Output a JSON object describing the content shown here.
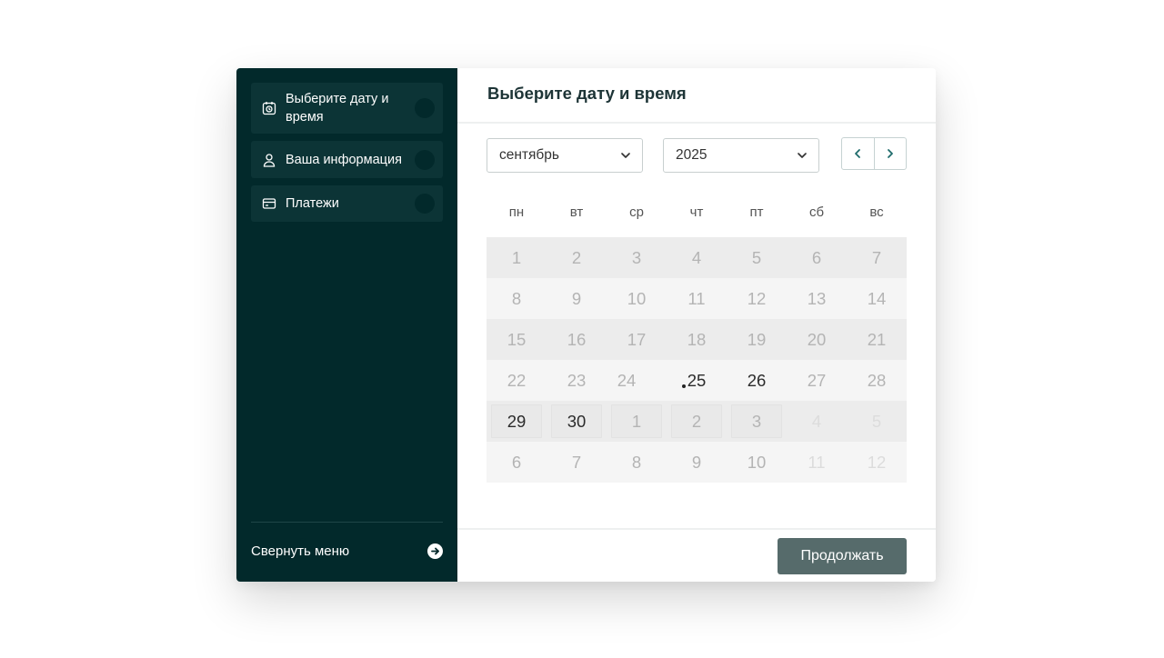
{
  "sidebar": {
    "steps": [
      {
        "label": "Выберите дату и время",
        "icon": "calendar-clock-icon"
      },
      {
        "label": "Ваша информация",
        "icon": "user-icon"
      },
      {
        "label": "Платежи",
        "icon": "credit-card-icon"
      }
    ],
    "collapse_label": "Свернуть меню",
    "colors": {
      "background": "#02292b",
      "step_background": "#0c3436"
    }
  },
  "main": {
    "title": "Выберите дату и время",
    "month_select": {
      "value": "сентябрь"
    },
    "year_select": {
      "value": "2025"
    },
    "weekdays": [
      "пн",
      "вт",
      "ср",
      "чт",
      "пт",
      "сб",
      "вс"
    ],
    "weeks": [
      [
        {
          "d": "1",
          "s": "disabled"
        },
        {
          "d": "2",
          "s": "disabled"
        },
        {
          "d": "3",
          "s": "disabled"
        },
        {
          "d": "4",
          "s": "disabled"
        },
        {
          "d": "5",
          "s": "disabled"
        },
        {
          "d": "6",
          "s": "disabled"
        },
        {
          "d": "7",
          "s": "disabled"
        }
      ],
      [
        {
          "d": "8",
          "s": "disabled"
        },
        {
          "d": "9",
          "s": "disabled"
        },
        {
          "d": "10",
          "s": "disabled"
        },
        {
          "d": "11",
          "s": "disabled"
        },
        {
          "d": "12",
          "s": "disabled"
        },
        {
          "d": "13",
          "s": "disabled"
        },
        {
          "d": "14",
          "s": "disabled"
        }
      ],
      [
        {
          "d": "15",
          "s": "disabled"
        },
        {
          "d": "16",
          "s": "disabled"
        },
        {
          "d": "17",
          "s": "disabled"
        },
        {
          "d": "18",
          "s": "disabled"
        },
        {
          "d": "19",
          "s": "disabled"
        },
        {
          "d": "20",
          "s": "disabled"
        },
        {
          "d": "21",
          "s": "disabled"
        }
      ],
      [
        {
          "d": "22",
          "s": "disabled"
        },
        {
          "d": "23",
          "s": "disabled"
        },
        {
          "d": "24",
          "s": "today"
        },
        {
          "d": "25",
          "s": "available"
        },
        {
          "d": "26",
          "s": "available"
        },
        {
          "d": "27",
          "s": "disabled"
        },
        {
          "d": "28",
          "s": "disabled"
        }
      ],
      [
        {
          "d": "29",
          "s": "available"
        },
        {
          "d": "30",
          "s": "available"
        },
        {
          "d": "1",
          "s": "outside"
        },
        {
          "d": "2",
          "s": "outside"
        },
        {
          "d": "3",
          "s": "outside"
        },
        {
          "d": "4",
          "s": "faint"
        },
        {
          "d": "5",
          "s": "faint"
        }
      ],
      [
        {
          "d": "6",
          "s": "disabled"
        },
        {
          "d": "7",
          "s": "disabled"
        },
        {
          "d": "8",
          "s": "disabled"
        },
        {
          "d": "9",
          "s": "disabled"
        },
        {
          "d": "10",
          "s": "disabled"
        },
        {
          "d": "11",
          "s": "faint"
        },
        {
          "d": "12",
          "s": "faint"
        }
      ]
    ],
    "continue_label": "Продолжать",
    "colors": {
      "continue_button": "#566b6b",
      "nav_arrow": "#1e6b6b"
    }
  }
}
